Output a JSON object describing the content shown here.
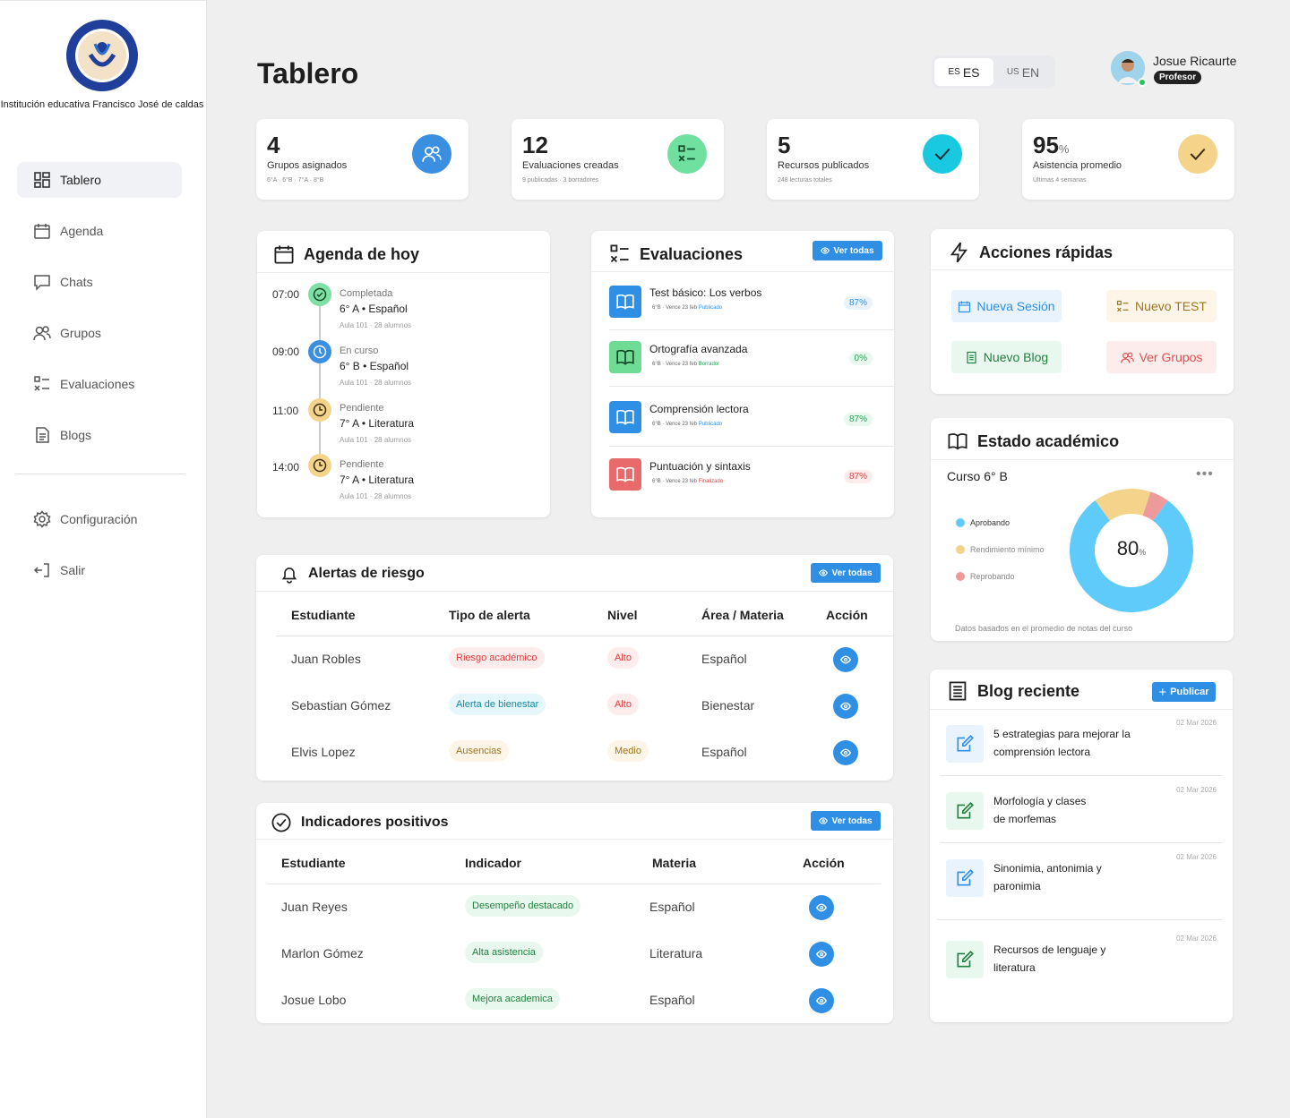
{
  "sidebar": {
    "institution": "Institución educativa Francisco José de caldas",
    "items": [
      {
        "label": "Tablero"
      },
      {
        "label": "Agenda"
      },
      {
        "label": "Chats"
      },
      {
        "label": "Grupos"
      },
      {
        "label": "Evaluaciones"
      },
      {
        "label": "Blogs"
      },
      {
        "label": "Configuración"
      },
      {
        "label": "Salir"
      }
    ]
  },
  "header": {
    "title": "Tablero",
    "lang": [
      {
        "code": "ES",
        "flag": "ES"
      },
      {
        "code": "EN",
        "flag": "US"
      }
    ],
    "user": {
      "name": "Josue Ricaurte",
      "role": "Profesor"
    }
  },
  "stats": [
    {
      "value": "4",
      "label": "Grupos asignados",
      "sub": "6°A · 6°B · 7°A · 8°B",
      "color": "#3b8fe0"
    },
    {
      "value": "12",
      "label": "Evaluaciones creadas",
      "sub": "9 publicadas · 3 borradores",
      "color": "#6fe0a0"
    },
    {
      "value": "5",
      "label": "Recursos publicados",
      "sub": "248 lecturas totales",
      "color": "#19c9e0"
    },
    {
      "value": "95",
      "unit": "%",
      "label": "Asistencia promedio",
      "sub": "Últimas 4 semanas",
      "color": "#f4d48a"
    }
  ],
  "agenda": {
    "title": "Agenda de hoy",
    "items": [
      {
        "time": "07:00",
        "status": "Completada",
        "class": "6° A • Español",
        "room": "Aula 101 · 28 alumnos"
      },
      {
        "time": "09:00",
        "status": "En curso",
        "class": "6° B • Español",
        "room": "Aula 101 · 28 alumnos"
      },
      {
        "time": "11:00",
        "status": "Pendiente",
        "class": "7° A • Literatura",
        "room": "Aula 101 · 28 alumnos"
      },
      {
        "time": "14:00",
        "status": "Pendiente",
        "class": "7° A • Literatura",
        "room": "Aula 101 · 28 alumnos"
      }
    ]
  },
  "evaluaciones": {
    "title": "Evaluaciones",
    "see_all": "Ver todas",
    "items": [
      {
        "title": "Test básico: Los verbos",
        "meta": "6°B · Vence 23 feb",
        "state": "Publicado",
        "pct": "87%"
      },
      {
        "title": "Ortografía avanzada",
        "meta": "6°B · Vence 23 feb",
        "state": "Borrador",
        "pct": "0%"
      },
      {
        "title": "Comprensión lectora",
        "meta": "6°B · Vence 23 feb",
        "state": "Publicado",
        "pct": "87%"
      },
      {
        "title": "Puntuación y sintaxis",
        "meta": "6°B · Vence 23 feb",
        "state": "Finalizado",
        "pct": "87%"
      }
    ]
  },
  "quick": {
    "title": "Acciones rápidas",
    "actions": [
      "Nueva Sesión",
      "Nuevo TEST",
      "Nuevo Blog",
      "Ver Grupos"
    ]
  },
  "academic": {
    "title": "Estado académico",
    "course": "Curso 6° B",
    "center_value": "80",
    "center_unit": "%",
    "legend": [
      "Aprobando",
      "Rendimiento mínimo",
      "Reprobando"
    ],
    "footnote": "Datos basados en el promedio de notas del curso"
  },
  "chart_data": {
    "type": "pie",
    "categories": [
      "Aprobando",
      "Rendimiento mínimo",
      "Reprobando"
    ],
    "values": [
      80,
      15,
      5
    ],
    "colors": [
      "#5ecbfa",
      "#f4d48a",
      "#ee9a9a"
    ]
  },
  "alerts": {
    "title": "Alertas de riesgo",
    "see_all": "Ver todas",
    "columns": [
      "Estudiante",
      "Tipo de alerta",
      "Nivel",
      "Área / Materia",
      "Acción"
    ],
    "rows": [
      {
        "student": "Juan Robles",
        "type": "Riesgo académico",
        "level": "Alto",
        "area": "Español"
      },
      {
        "student": "Sebastian Gómez",
        "type": "Alerta de bienestar",
        "level": "Alto",
        "area": "Bienestar"
      },
      {
        "student": "Elvis Lopez",
        "type": "Ausencias",
        "level": "Medio",
        "area": "Español"
      }
    ]
  },
  "positive": {
    "title": "Indicadores positivos",
    "see_all": "Ver todas",
    "columns": [
      "Estudiante",
      "Indicador",
      "Materia",
      "Acción"
    ],
    "rows": [
      {
        "student": "Juan Reyes",
        "indicator": "Desempeño destacado",
        "subject": "Español"
      },
      {
        "student": "Marlon Gómez",
        "indicator": "Alta asistencia",
        "subject": "Literatura"
      },
      {
        "student": "Josue Lobo",
        "indicator": "Mejora academica",
        "subject": "Español"
      }
    ]
  },
  "blog": {
    "title": "Blog reciente",
    "publish": "Publicar",
    "items": [
      {
        "title": "5 estrategias para mejorar la comprensión lectora",
        "date": "02 Mar 2026"
      },
      {
        "title": "Morfología y clases de morfemas",
        "date": "02 Mar 2026"
      },
      {
        "title": "Sinonimia, antonimia y paronimia",
        "date": "02 Mar 2026"
      },
      {
        "title": "Recursos de lenguaje y literatura",
        "date": "02 Mar 2026"
      }
    ]
  }
}
